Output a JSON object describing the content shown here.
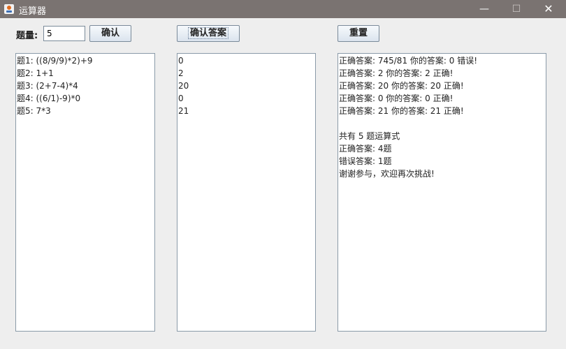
{
  "window": {
    "title": "运算器",
    "controls": {
      "minimize": "—",
      "maximize": "☐",
      "close": "✕"
    }
  },
  "toolbar": {
    "count_label": "题量:",
    "count_value": "5",
    "confirm_label": "确认",
    "confirm_answer_label": "确认答案",
    "reset_label": "重置"
  },
  "questions": [
    "题1: ((8/9/9)*2)+9",
    "题2: 1+1",
    "题3: (2+7-4)*4",
    "题4: ((6/1)-9)*0",
    "题5: 7*3"
  ],
  "answers": [
    "0",
    "2",
    "20",
    "0",
    "21"
  ],
  "results": [
    "正确答案: 745/81 你的答案: 0 错误!",
    "正确答案: 2 你的答案: 2 正确!",
    "正确答案: 20 你的答案: 20 正确!",
    "正确答案: 0 你的答案: 0 正确!",
    "正确答案: 21 你的答案: 21 正确!",
    "",
    "共有 5 题运算式",
    "正确答案: 4题",
    "错误答案: 1题",
    "谢谢参与，欢迎再次挑战!"
  ]
}
